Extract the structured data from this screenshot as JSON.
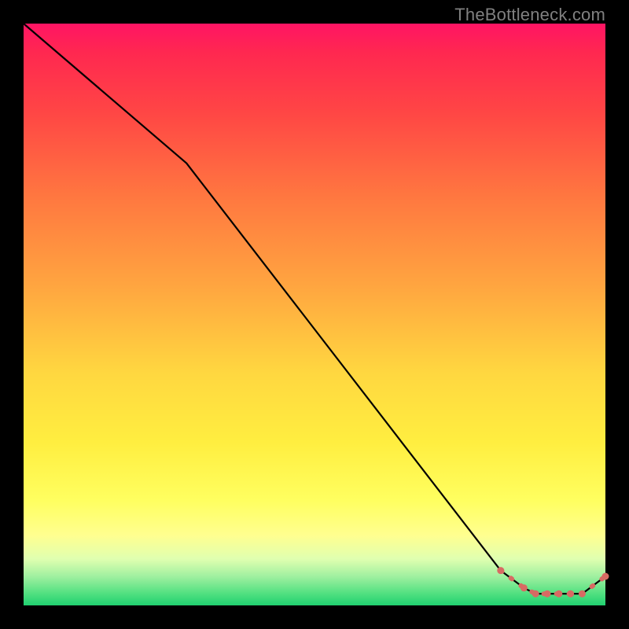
{
  "watermark": "TheBottleneck.com",
  "chart_data": {
    "type": "line",
    "title": "",
    "xlabel": "",
    "ylabel": "",
    "xlim": [
      0,
      100
    ],
    "ylim": [
      0,
      100
    ],
    "series": [
      {
        "name": "curve",
        "style": "solid-black",
        "x": [
          0,
          28,
          82,
          86,
          88,
          90,
          92,
          94,
          96,
          100
        ],
        "y": [
          100,
          76,
          6,
          3,
          2,
          2,
          2,
          2,
          2,
          5
        ]
      },
      {
        "name": "highlight-dots",
        "style": "red-dashed-dots",
        "x": [
          82,
          86,
          88,
          90,
          92,
          94,
          96,
          100
        ],
        "y": [
          6,
          3,
          2,
          2,
          2,
          2,
          2,
          5
        ]
      }
    ],
    "grid": false,
    "legend": false
  }
}
